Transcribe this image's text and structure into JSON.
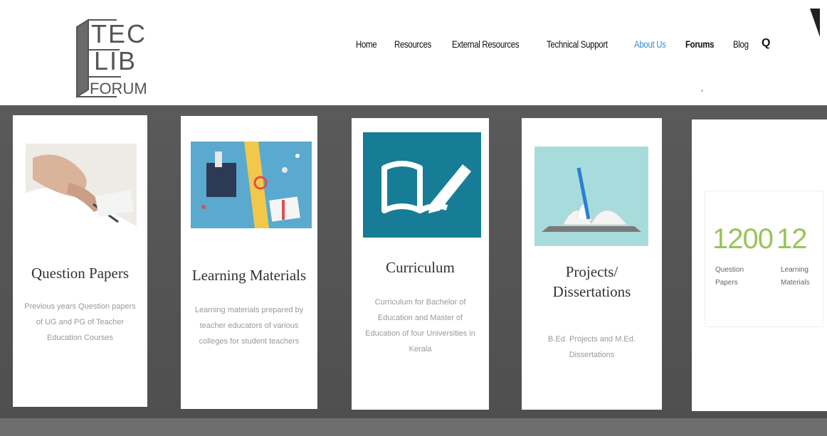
{
  "logo": {
    "line1": "TEC",
    "line2": "LIB",
    "line3": "FORUM"
  },
  "nav": {
    "items": [
      {
        "label": "Home"
      },
      {
        "label": "Resources"
      },
      {
        "label": "External Resources"
      },
      {
        "label": "Technical Support"
      },
      {
        "label": "About Us",
        "active": true
      },
      {
        "label": "Forums"
      },
      {
        "label": "Blog"
      }
    ],
    "search_icon": "Q"
  },
  "cards": [
    {
      "title": "Question Papers",
      "desc": [
        "Previous years Question papers",
        "of UG and PG of Teacher",
        "Education Courses"
      ]
    },
    {
      "title": "Learning Materials",
      "desc": [
        "Learning materials prepared by",
        "teacher educators of various",
        "colleges for student teachers"
      ]
    },
    {
      "title": "Curriculum",
      "desc": [
        "Curriculum for Bachelor of",
        "Education and Master of",
        "Education of four Universities in",
        "Kerala"
      ]
    },
    {
      "title_lines": [
        "Projects/",
        "Dissertations"
      ],
      "desc": [
        "B.Ed. Projects and M.Ed.",
        "Dissertations"
      ]
    }
  ],
  "stats": [
    {
      "value": "1200",
      "label_lines": [
        "Question",
        "Papers"
      ]
    },
    {
      "value": "12",
      "label_lines": [
        "Learning",
        "Materials"
      ]
    }
  ],
  "colors": {
    "accent_blue": "#3a8fd6",
    "stat_green": "#9bc35a",
    "band": "#565656"
  }
}
